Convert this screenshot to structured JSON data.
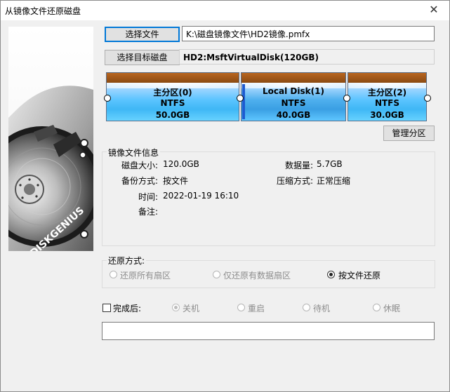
{
  "window": {
    "title": "从镜像文件还原磁盘",
    "close_glyph": "✕"
  },
  "logo": {
    "brand": "DISKGENIUS"
  },
  "source": {
    "button": "选择文件",
    "path": "K:\\磁盘镜像文件\\HD2镜像.pmfx"
  },
  "target": {
    "button": "选择目标磁盘",
    "disk": "HD2:MsftVirtualDisk(120GB)"
  },
  "partitions": [
    {
      "name": "主分区(0)",
      "fs": "NTFS",
      "size": "50.0GB"
    },
    {
      "name": "Local Disk(1)",
      "fs": "NTFS",
      "size": "40.0GB"
    },
    {
      "name": "主分区(2)",
      "fs": "NTFS",
      "size": "30.0GB"
    }
  ],
  "manage_button": "管理分区",
  "info": {
    "title": "镜像文件信息",
    "disk_size_label": "磁盘大小:",
    "disk_size": "120.0GB",
    "data_amount_label": "数据量:",
    "data_amount": "5.7GB",
    "backup_label": "备份方式:",
    "backup": "按文件",
    "compress_label": "压缩方式:",
    "compress": "正常压缩",
    "time_label": "时间:",
    "time": "2022-01-19 16:10",
    "note_label": "备注:",
    "note": ""
  },
  "restore": {
    "title": "还原方式:",
    "options": [
      "还原所有扇区",
      "仅还原有数据扇区",
      "按文件还原"
    ],
    "selected": 2
  },
  "after": {
    "label": "完成后:",
    "options": [
      "关机",
      "重启",
      "待机",
      "休眠"
    ],
    "selected": 0
  },
  "progress": {
    "value": 0
  },
  "colors": {
    "partition_cap": "#a0561a",
    "partition_fill": "#4fbef7",
    "focus": "#0078d7"
  }
}
